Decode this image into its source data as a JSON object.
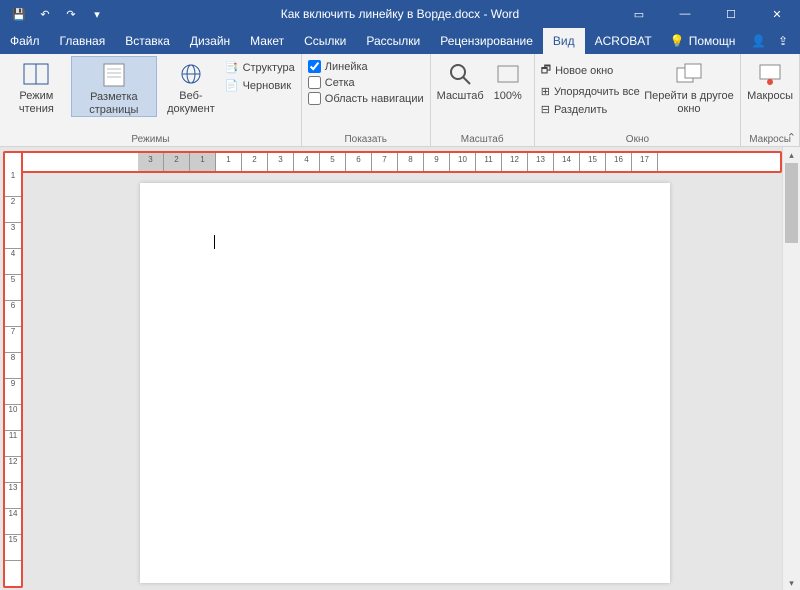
{
  "title": "Как включить линейку в Ворде.docx - Word",
  "qat": {
    "save": "💾",
    "undo": "↶",
    "redo": "↷",
    "custom": "▾"
  },
  "win": {
    "ribbon": "▭",
    "min": "—",
    "max": "☐",
    "close": "✕"
  },
  "tabs": {
    "file": "Файл",
    "items": [
      "Главная",
      "Вставка",
      "Дизайн",
      "Макет",
      "Ссылки",
      "Рассылки",
      "Рецензирование",
      "Вид",
      "ACROBAT"
    ],
    "active": "Вид",
    "help": "Помощн"
  },
  "ribbon": {
    "modes": {
      "label": "Режимы",
      "read": "Режим чтения",
      "layout": "Разметка страницы",
      "web": "Веб-документ",
      "outline": "Структура",
      "draft": "Черновик"
    },
    "show": {
      "label": "Показать",
      "ruler": "Линейка",
      "grid": "Сетка",
      "nav": "Область навигации"
    },
    "zoom": {
      "label": "Масштаб",
      "zoom": "Масштаб",
      "hundred": "100%"
    },
    "window": {
      "label": "Окно",
      "new": "Новое окно",
      "arrange": "Упорядочить все",
      "split": "Разделить",
      "switch": "Перейти в другое окно"
    },
    "macros": {
      "label": "Макросы",
      "btn": "Макросы"
    }
  },
  "hruler_neg": [
    3,
    2,
    1
  ],
  "hruler_pos": [
    1,
    2,
    3,
    4,
    5,
    6,
    7,
    8,
    9,
    10,
    11,
    12,
    13,
    14,
    15,
    16,
    17
  ],
  "vruler": [
    1,
    2,
    3,
    4,
    5,
    6,
    7,
    8,
    9,
    10,
    11,
    12,
    13,
    14,
    15
  ]
}
